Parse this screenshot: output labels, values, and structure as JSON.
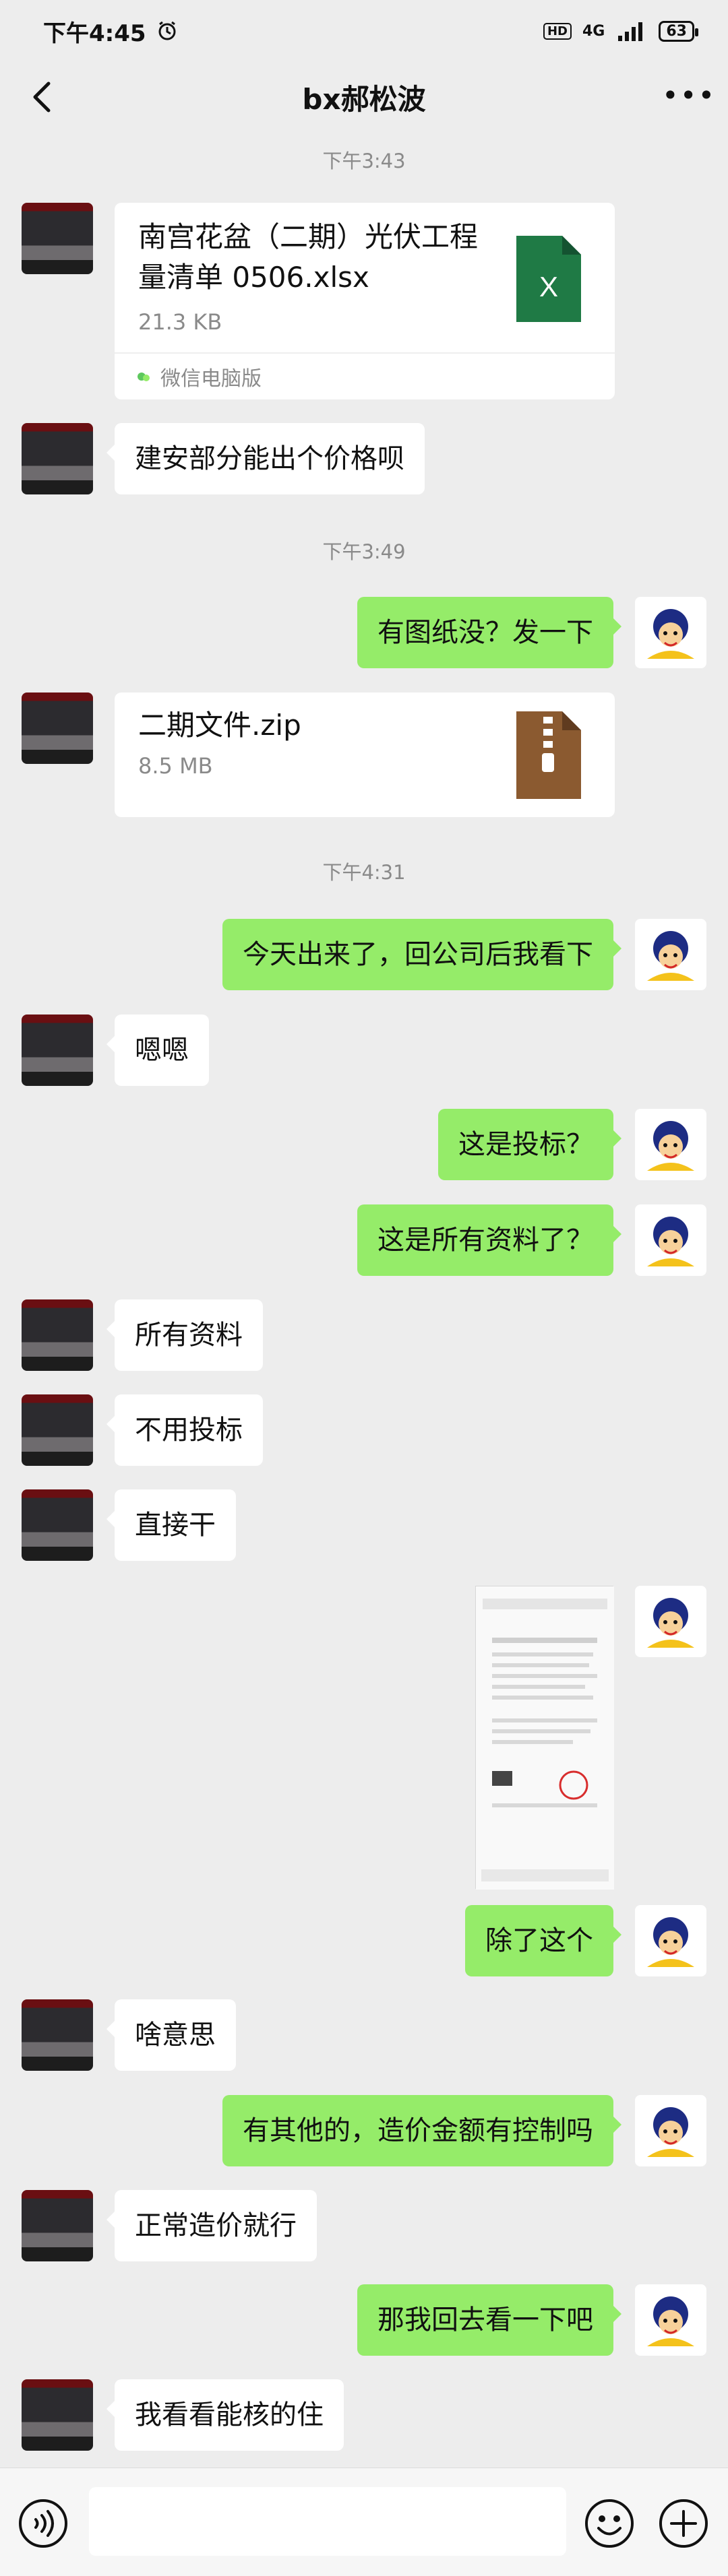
{
  "status_bar": {
    "time": "下午4:45",
    "hd": "HD",
    "network": "4G",
    "battery": "63"
  },
  "header": {
    "title": "bx郝松波"
  },
  "messages": {
    "time_1": "下午3:43",
    "file_1": {
      "name_line1": "南宫花盆（二期）光伏工程",
      "name_line2": "量清单 0506.xlsx",
      "size": "21.3 KB",
      "source": "微信电脑版",
      "icon": "excel-file-icon"
    },
    "text_1": "建安部分能出个价格呗",
    "time_2": "下午3:49",
    "text_2": "有图纸没？发一下",
    "file_2": {
      "name": "二期文件.zip",
      "size": "8.5 MB",
      "icon": "zip-file-icon"
    },
    "time_3": "下午4:31",
    "text_3": "今天出来了，回公司后我看下",
    "text_4": "嗯嗯",
    "text_5": "这是投标？",
    "text_6": "这是所有资料了？",
    "text_7": "所有资料",
    "text_8": "不用投标",
    "text_9": "直接干",
    "text_10": "除了这个",
    "text_11": "啥意思",
    "text_12": "有其他的，造价金额有控制吗",
    "text_13": "正常造价就行",
    "text_14": "那我回去看一下吧",
    "text_15": "我看看能核的住"
  },
  "colors": {
    "background": "#ededed",
    "outgoing_bubble": "#95ec69",
    "incoming_bubble": "#ffffff",
    "excel_green": "#1f7a45",
    "zip_brown": "#8b5a30"
  },
  "input": {
    "placeholder": ""
  }
}
